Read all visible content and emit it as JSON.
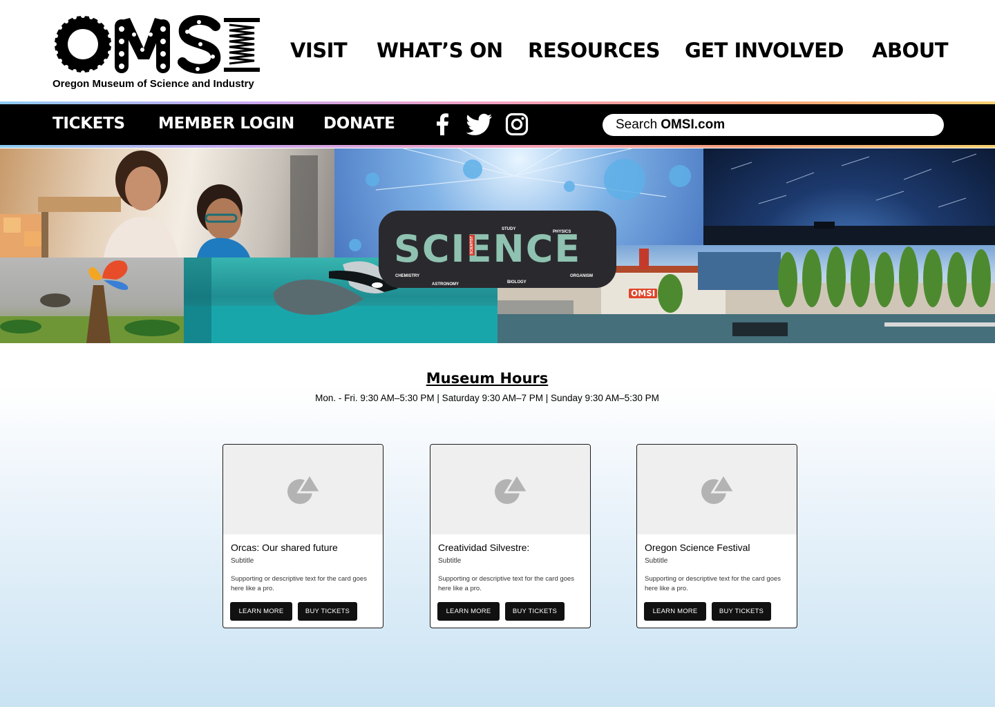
{
  "header": {
    "logo_text": "OMSI",
    "logo_tagline": "Oregon Museum of Science and Industry",
    "nav": [
      {
        "label": "VISIT"
      },
      {
        "label": "WHAT’S ON"
      },
      {
        "label": "RESOURCES"
      },
      {
        "label": "GET INVOLVED"
      },
      {
        "label": "ABOUT"
      }
    ]
  },
  "subbar": {
    "links": [
      {
        "label": "TICKETS"
      },
      {
        "label": "MEMBER LOGIN"
      },
      {
        "label": "DONATE"
      }
    ],
    "social": [
      "facebook-icon",
      "twitter-icon",
      "instagram-icon"
    ],
    "search": {
      "prefix": "Search",
      "site": "OMSI.com"
    }
  },
  "hero": {
    "banner_text": "SCIENCE",
    "banner_words": [
      "STUDY",
      "PHYSICS",
      "CHEMISTRY",
      "ASTRONOMY",
      "BIOLOGY",
      "ORGANISM",
      "SCIENTIST"
    ],
    "building_sign": "OMSI"
  },
  "hours": {
    "title": "Museum Hours",
    "text": "Mon. - Fri. 9:30 AM–5:30 PM | Saturday 9:30 AM–7 PM | Sunday 9:30 AM–5:30 PM"
  },
  "cards": [
    {
      "title": "Orcas: Our shared future",
      "subtitle": "Subtitle",
      "description": "Supporting or descriptive text for the card goes here like a pro.",
      "learn_label": "LEARN MORE",
      "buy_label": "BUY TICKETS"
    },
    {
      "title": "Creatividad Silvestre:",
      "subtitle": "Subtitle",
      "description": "Supporting or descriptive text for the card goes here like a pro.",
      "learn_label": "LEARN MORE",
      "buy_label": "BUY TICKETS"
    },
    {
      "title": "Oregon Science Festival",
      "subtitle": "Subtitle",
      "description": "Supporting or descriptive text for the card goes here like a pro.",
      "learn_label": "LEARN MORE",
      "buy_label": "BUY TICKETS"
    }
  ],
  "colors": {
    "bar": "#000000",
    "background_bottom": "#c9e3f3",
    "button": "#111111"
  }
}
